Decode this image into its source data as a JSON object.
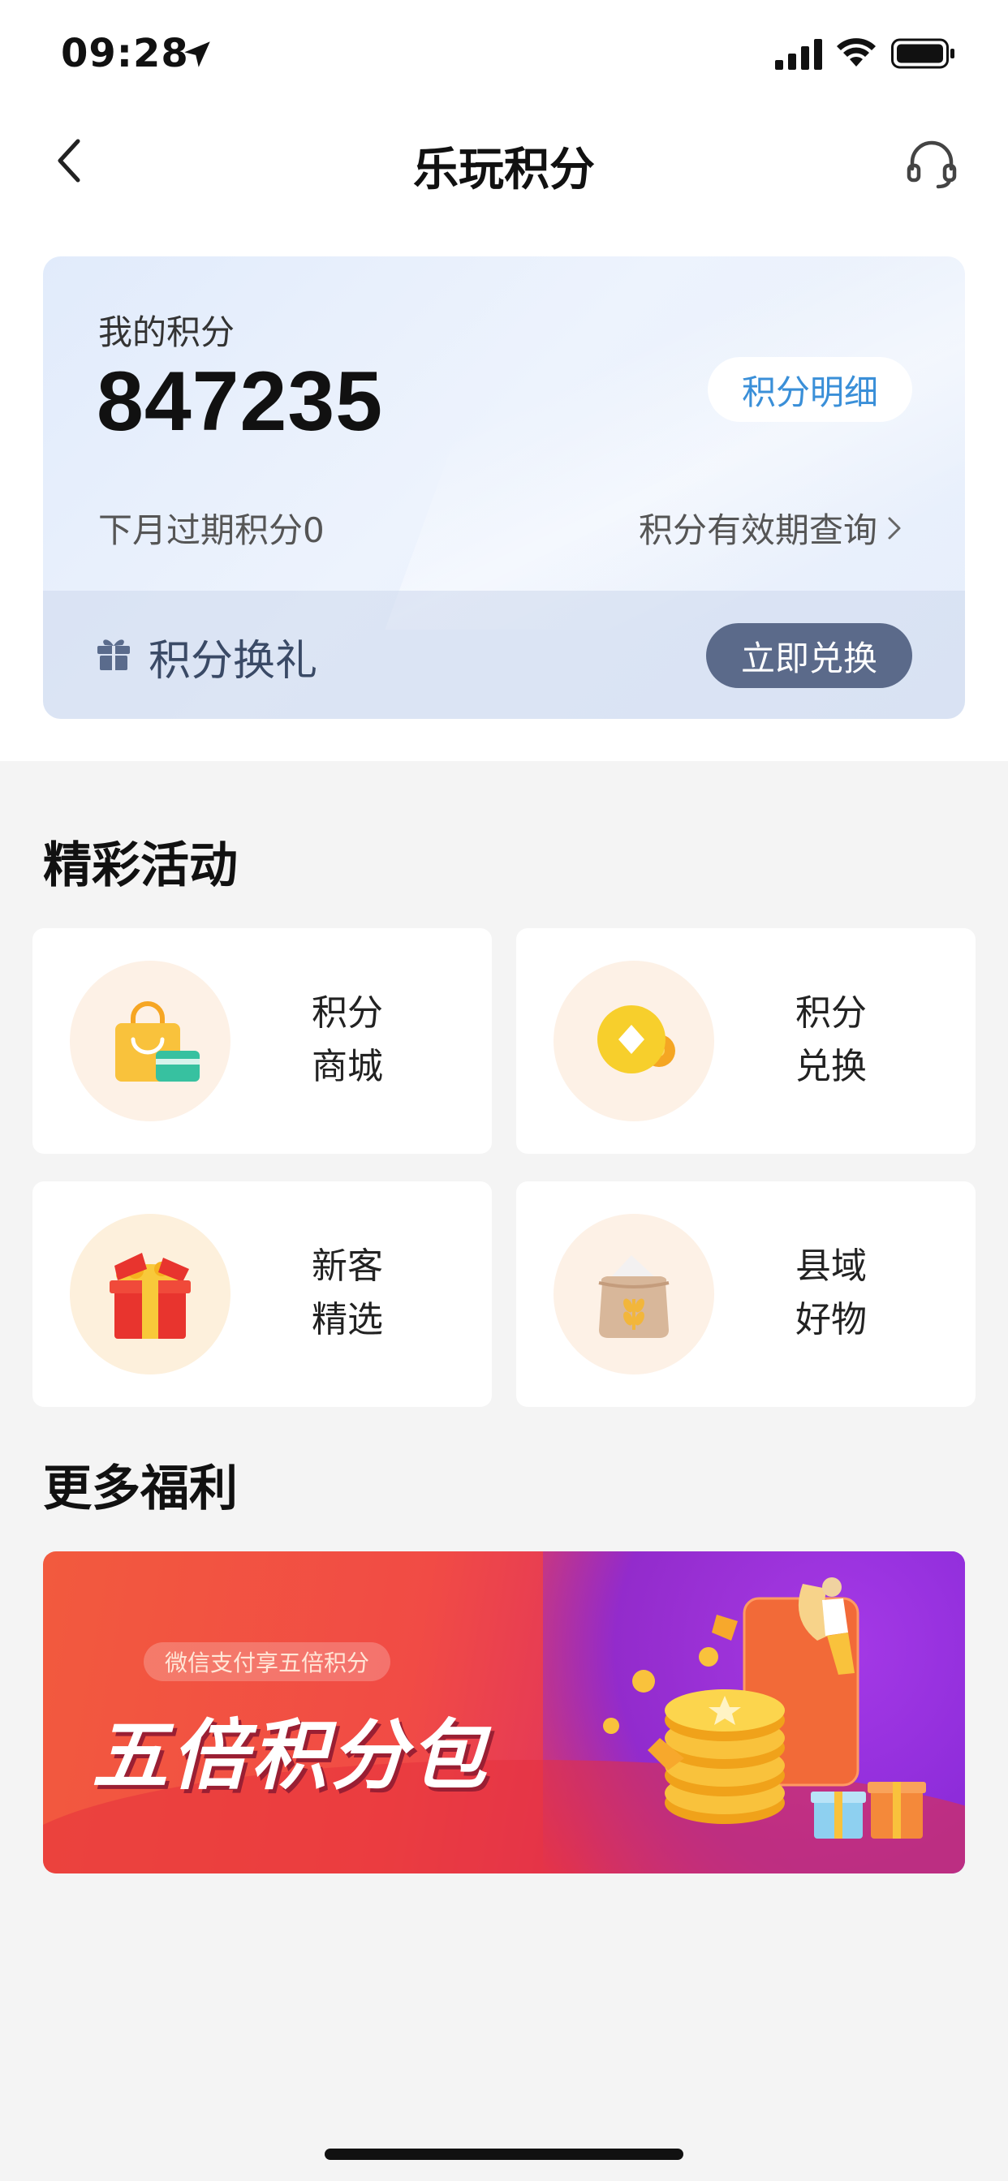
{
  "status_bar": {
    "time": "09:28"
  },
  "nav": {
    "title": "乐玩积分"
  },
  "points_card": {
    "label": "我的积分",
    "value": "847235",
    "detail_button": "积分明细",
    "expire_text": "下月过期积分0",
    "validity_link": "积分有效期查询",
    "exchange_label": "积分换礼",
    "redeem_button": "立即兑换"
  },
  "activities": {
    "title": "精彩活动",
    "items": [
      {
        "line1": "积分",
        "line2": "商城",
        "icon": "shopping-bag-icon"
      },
      {
        "line1": "积分",
        "line2": "兑换",
        "icon": "coin-icon"
      },
      {
        "line1": "新客",
        "line2": "精选",
        "icon": "gift-box-icon"
      },
      {
        "line1": "县域",
        "line2": "好物",
        "icon": "grain-sack-icon"
      }
    ]
  },
  "more": {
    "title": "更多福利",
    "banner_tag": "微信支付享五倍积分",
    "banner_title": "五倍积分包"
  },
  "colors": {
    "accent_blue": "#3a8fd8",
    "redeem_button": "#5b6a8a",
    "banner_red": "#f14b45",
    "banner_purple": "#8a2ad8"
  }
}
